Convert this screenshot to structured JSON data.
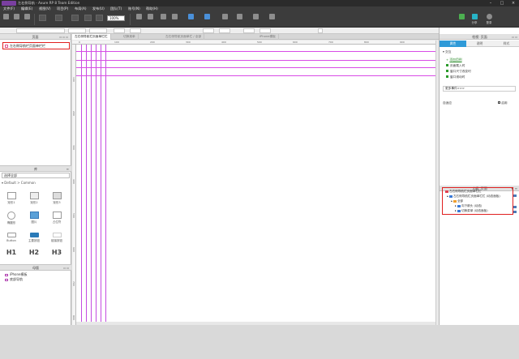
{
  "titlebar": {
    "title": "左右侧导航 - Axure RP 8 Team Edition"
  },
  "menus": [
    "文件(F)",
    "编辑(E)",
    "视图(V)",
    "项目(P)",
    "布局(A)",
    "发布(U)",
    "团队(T)",
    "账号(N)",
    "帮助(H)"
  ],
  "toolbar": {
    "zoom": "100%",
    "share": "分享",
    "login": "登录",
    "page_label": "页面"
  },
  "tabs": [
    "左右侧导航栏页面单栏栏",
    "切换菜单",
    "左右侧导航页面单栏 / 全部",
    "iPhone模板"
  ],
  "left_panel": {
    "pages_title": "页面",
    "page_item": "左右侧导航栏页面单栏栏",
    "library_title": "库",
    "library_select": "选择全部",
    "library_group": "Default > Common",
    "widgets": [
      {
        "label": "矩形1",
        "kind": "box"
      },
      {
        "label": "矩形2",
        "kind": "box"
      },
      {
        "label": "矩形3",
        "kind": "box"
      },
      {
        "label": "椭圆形",
        "kind": "circle"
      },
      {
        "label": "图片",
        "kind": "image"
      },
      {
        "label": "占位符",
        "kind": "placeholder"
      },
      {
        "label": "Button",
        "kind": "button"
      },
      {
        "label": "主要按钮",
        "kind": "button-primary"
      },
      {
        "label": "链接按钮",
        "kind": "link"
      },
      {
        "label": "H1",
        "kind": "h1"
      },
      {
        "label": "H2",
        "kind": "h2"
      },
      {
        "label": "H3",
        "kind": "h3"
      }
    ],
    "masters_title": "母版",
    "masters": [
      "iPhone模板",
      "底部导航"
    ]
  },
  "canvas": {
    "ruler_h": [
      "0",
      "100",
      "200",
      "300",
      "400",
      "500",
      "600",
      "700",
      "800",
      "900",
      "1000"
    ],
    "ruler_v": [
      "100",
      "200",
      "300",
      "400",
      "500",
      "600",
      "700",
      "800"
    ]
  },
  "right_panel": {
    "title": "检视: 页面",
    "tabs": [
      "属性",
      "说明",
      "样式"
    ],
    "section": "交互",
    "add_case": "添加用例",
    "events": [
      "页面载入时",
      "窗口尺寸改变时",
      "窗口滚动时"
    ],
    "more": "更多事件>>>",
    "adaptive": "自适应",
    "enable": "启用"
  },
  "outline": {
    "title": "大纲: 页面",
    "items": [
      {
        "label": "左右侧导航栏页面单栏栏",
        "level": 0
      },
      {
        "label": "左右侧导航栏页面单栏栏 (动态面板)",
        "level": 1
      },
      {
        "label": "全部",
        "level": 2
      },
      {
        "label": "向下箭头 (动态)",
        "level": 3
      },
      {
        "label": "切换菜单 (动态面板)",
        "level": 3
      }
    ]
  }
}
